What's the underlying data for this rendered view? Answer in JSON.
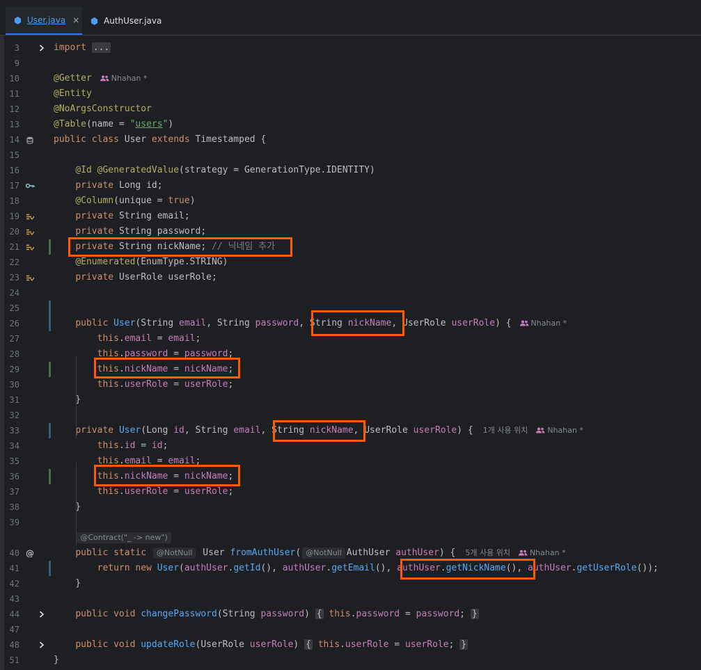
{
  "tabs": [
    {
      "label": "User.java",
      "active": true,
      "close": "×"
    },
    {
      "label": "AuthUser.java",
      "active": false
    }
  ],
  "colors": {
    "background": "#1e1f22",
    "keyword": "#cf8e6d",
    "annotation": "#b3ae60",
    "field": "#c77dbb",
    "string": "#6aab73",
    "method": "#56a8f5",
    "highlight_box": "#ff5a00"
  },
  "icons": {
    "database": "database-icon",
    "key": "key-icon",
    "field_override": "implements-icon",
    "at": "at-icon",
    "chevron": "chevron-right-icon",
    "authors": "people-icon"
  },
  "lines": [
    {
      "n": "3",
      "fold": true,
      "code": [
        [
          "k",
          "import "
        ],
        [
          "fb",
          "..."
        ]
      ]
    },
    {
      "n": "9",
      "code": []
    },
    {
      "n": "10",
      "code": [
        [
          "a",
          "@Getter"
        ]
      ],
      "author": "Nhahan *"
    },
    {
      "n": "11",
      "code": [
        [
          "a",
          "@Entity"
        ]
      ]
    },
    {
      "n": "12",
      "code": [
        [
          "a",
          "@NoArgsConstructor"
        ]
      ]
    },
    {
      "n": "13",
      "code": [
        [
          "a",
          "@Table"
        ],
        [
          "p",
          "("
        ],
        [
          "pr",
          "name = "
        ],
        [
          "s",
          "\""
        ],
        [
          "ss",
          "users"
        ],
        [
          "s",
          "\""
        ],
        [
          "p",
          ")"
        ]
      ]
    },
    {
      "n": "14",
      "gutter": "database",
      "code": [
        [
          "k",
          "public class "
        ],
        [
          "p",
          "User "
        ],
        [
          "k",
          "extends "
        ],
        [
          "p",
          "Timestamped {"
        ]
      ]
    },
    {
      "n": "15",
      "code": []
    },
    {
      "n": "16",
      "code": [
        [
          "p",
          "    "
        ],
        [
          "a",
          "@Id @GeneratedValue"
        ],
        [
          "p",
          "("
        ],
        [
          "pr",
          "strategy = "
        ],
        [
          "p",
          "GenerationType.IDENTITY)"
        ]
      ]
    },
    {
      "n": "17",
      "gutter": "key",
      "code": [
        [
          "p",
          "    "
        ],
        [
          "k",
          "private "
        ],
        [
          "p",
          "Long id;"
        ]
      ]
    },
    {
      "n": "18",
      "code": [
        [
          "p",
          "    "
        ],
        [
          "a",
          "@Column"
        ],
        [
          "p",
          "("
        ],
        [
          "pr",
          "unique = "
        ],
        [
          "k",
          "true"
        ],
        [
          "p",
          ")"
        ]
      ]
    },
    {
      "n": "19",
      "gutter": "impl",
      "code": [
        [
          "p",
          "    "
        ],
        [
          "k",
          "private "
        ],
        [
          "p",
          "String email;"
        ]
      ]
    },
    {
      "n": "20",
      "gutter": "impl",
      "code": [
        [
          "p",
          "    "
        ],
        [
          "k",
          "private "
        ],
        [
          "p",
          "String password;"
        ]
      ]
    },
    {
      "n": "21",
      "gutter": "impl",
      "change": "g",
      "code": [
        [
          "p",
          "    "
        ],
        [
          "k",
          "private "
        ],
        [
          "p",
          "String nickName; "
        ],
        [
          "c",
          "// 닉네임 추가"
        ]
      ]
    },
    {
      "n": "22",
      "code": [
        [
          "p",
          "    "
        ],
        [
          "a",
          "@Enumerated"
        ],
        [
          "p",
          "(EnumType.STRING)"
        ]
      ]
    },
    {
      "n": "23",
      "gutter": "impl",
      "code": [
        [
          "p",
          "    "
        ],
        [
          "k",
          "private "
        ],
        [
          "p",
          "UserRole userRole;"
        ]
      ]
    },
    {
      "n": "24",
      "code": []
    },
    {
      "n": "25",
      "change": "b",
      "code": []
    },
    {
      "n": "26",
      "change": "b",
      "code": [
        [
          "p",
          "    "
        ],
        [
          "k",
          "public "
        ],
        [
          "m",
          "User"
        ],
        [
          "p",
          "(String "
        ],
        [
          "f2",
          "email"
        ],
        [
          "p",
          ", String "
        ],
        [
          "f2",
          "password"
        ],
        [
          "p",
          ", String "
        ],
        [
          "f2",
          "nickName"
        ],
        [
          "p",
          ", UserRole "
        ],
        [
          "f2",
          "userRole"
        ],
        [
          "p",
          ") {"
        ]
      ],
      "author": "Nhahan *"
    },
    {
      "n": "27",
      "code": [
        [
          "p",
          "        "
        ],
        [
          "k",
          "this"
        ],
        [
          "p",
          "."
        ],
        [
          "f",
          "email"
        ],
        [
          "p",
          " = "
        ],
        [
          "f2",
          "email"
        ],
        [
          "p",
          ";"
        ]
      ]
    },
    {
      "n": "28",
      "code": [
        [
          "p",
          "        "
        ],
        [
          "k",
          "this"
        ],
        [
          "p",
          "."
        ],
        [
          "f",
          "password"
        ],
        [
          "p",
          " = "
        ],
        [
          "f2",
          "password"
        ],
        [
          "p",
          ";"
        ]
      ]
    },
    {
      "n": "29",
      "change": "g",
      "code": [
        [
          "p",
          "        "
        ],
        [
          "k",
          "this"
        ],
        [
          "p",
          "."
        ],
        [
          "f",
          "nickName"
        ],
        [
          "p",
          " = "
        ],
        [
          "f2",
          "nickName"
        ],
        [
          "p",
          ";"
        ]
      ]
    },
    {
      "n": "30",
      "code": [
        [
          "p",
          "        "
        ],
        [
          "k",
          "this"
        ],
        [
          "p",
          "."
        ],
        [
          "f",
          "userRole"
        ],
        [
          "p",
          " = "
        ],
        [
          "f2",
          "userRole"
        ],
        [
          "p",
          ";"
        ]
      ]
    },
    {
      "n": "31",
      "code": [
        [
          "p",
          "    }"
        ]
      ]
    },
    {
      "n": "32",
      "code": []
    },
    {
      "n": "33",
      "change": "b",
      "code": [
        [
          "p",
          "    "
        ],
        [
          "k",
          "private "
        ],
        [
          "m",
          "User"
        ],
        [
          "p",
          "(Long "
        ],
        [
          "f2",
          "id"
        ],
        [
          "p",
          ", String "
        ],
        [
          "f2",
          "email"
        ],
        [
          "p",
          ", String "
        ],
        [
          "f2",
          "nickName"
        ],
        [
          "p",
          ", UserRole "
        ],
        [
          "f2",
          "userRole"
        ],
        [
          "p",
          ") {"
        ]
      ],
      "usage": "1개 사용 위치",
      "author": "Nhahan *"
    },
    {
      "n": "34",
      "code": [
        [
          "p",
          "        "
        ],
        [
          "k",
          "this"
        ],
        [
          "p",
          "."
        ],
        [
          "f",
          "id"
        ],
        [
          "p",
          " = "
        ],
        [
          "f2",
          "id"
        ],
        [
          "p",
          ";"
        ]
      ]
    },
    {
      "n": "35",
      "code": [
        [
          "p",
          "        "
        ],
        [
          "k",
          "this"
        ],
        [
          "p",
          "."
        ],
        [
          "f",
          "email"
        ],
        [
          "p",
          " = "
        ],
        [
          "f2",
          "email"
        ],
        [
          "p",
          ";"
        ]
      ]
    },
    {
      "n": "36",
      "change": "g",
      "code": [
        [
          "p",
          "        "
        ],
        [
          "k",
          "this"
        ],
        [
          "p",
          "."
        ],
        [
          "f",
          "nickName"
        ],
        [
          "p",
          " = "
        ],
        [
          "f2",
          "nickName"
        ],
        [
          "p",
          ";"
        ]
      ]
    },
    {
      "n": "37",
      "code": [
        [
          "p",
          "        "
        ],
        [
          "k",
          "this"
        ],
        [
          "p",
          "."
        ],
        [
          "f",
          "userRole"
        ],
        [
          "p",
          " = "
        ],
        [
          "f2",
          "userRole"
        ],
        [
          "p",
          ";"
        ]
      ]
    },
    {
      "n": "38",
      "code": [
        [
          "p",
          "    }"
        ]
      ]
    },
    {
      "n": "39",
      "code": []
    },
    {
      "n": "",
      "code": [
        [
          "p",
          "    "
        ],
        [
          "inlay",
          "@Contract(\"_ -> new\")"
        ]
      ]
    },
    {
      "n": "40",
      "gutter": "at",
      "code": [
        [
          "p",
          "    "
        ],
        [
          "k",
          "public static "
        ],
        [
          "inlaybox",
          "@NotNull"
        ],
        [
          "p",
          " User "
        ],
        [
          "m",
          "fromAuthUser"
        ],
        [
          "p",
          "("
        ],
        [
          "inlaybox",
          "@NotNull"
        ],
        [
          "p",
          "AuthUser "
        ],
        [
          "f2",
          "authUser"
        ],
        [
          "p",
          ") {"
        ]
      ],
      "usage": "5개 사용 위치",
      "author": "Nhahan *"
    },
    {
      "n": "41",
      "change": "b",
      "code": [
        [
          "p",
          "        "
        ],
        [
          "k",
          "return new "
        ],
        [
          "m",
          "User"
        ],
        [
          "p",
          "("
        ],
        [
          "f2",
          "authUser"
        ],
        [
          "p",
          "."
        ],
        [
          "m",
          "getId"
        ],
        [
          "p",
          "(), "
        ],
        [
          "f2",
          "authUser"
        ],
        [
          "p",
          "."
        ],
        [
          "m",
          "getEmail"
        ],
        [
          "p",
          "(), "
        ],
        [
          "f2",
          "authUser"
        ],
        [
          "p",
          "."
        ],
        [
          "m",
          "getNickName"
        ],
        [
          "p",
          "(), "
        ],
        [
          "f2",
          "authUser"
        ],
        [
          "p",
          "."
        ],
        [
          "m",
          "getUserRole"
        ],
        [
          "p",
          "());"
        ]
      ]
    },
    {
      "n": "42",
      "code": [
        [
          "p",
          "    }"
        ]
      ]
    },
    {
      "n": "43",
      "code": []
    },
    {
      "n": "44",
      "fold": true,
      "code": [
        [
          "p",
          "    "
        ],
        [
          "k",
          "public void "
        ],
        [
          "m",
          "changePassword"
        ],
        [
          "p",
          "(String "
        ],
        [
          "f2",
          "password"
        ],
        [
          "p",
          ") "
        ],
        [
          "fb",
          "{"
        ],
        [
          "p",
          " "
        ],
        [
          "k",
          "this"
        ],
        [
          "p",
          "."
        ],
        [
          "f",
          "password"
        ],
        [
          "p",
          " = "
        ],
        [
          "f2",
          "password"
        ],
        [
          "p",
          "; "
        ],
        [
          "fb",
          "}"
        ]
      ]
    },
    {
      "n": "47",
      "code": []
    },
    {
      "n": "48",
      "fold": true,
      "code": [
        [
          "p",
          "    "
        ],
        [
          "k",
          "public void "
        ],
        [
          "m",
          "updateRole"
        ],
        [
          "p",
          "(UserRole "
        ],
        [
          "f2",
          "userRole"
        ],
        [
          "p",
          ") "
        ],
        [
          "fb",
          "{"
        ],
        [
          "p",
          " "
        ],
        [
          "k",
          "this"
        ],
        [
          "p",
          "."
        ],
        [
          "f",
          "userRole"
        ],
        [
          "p",
          " = "
        ],
        [
          "f2",
          "userRole"
        ],
        [
          "p",
          "; "
        ],
        [
          "fb",
          "}"
        ]
      ]
    },
    {
      "n": "51",
      "code": [
        [
          "p",
          "}"
        ]
      ]
    }
  ]
}
